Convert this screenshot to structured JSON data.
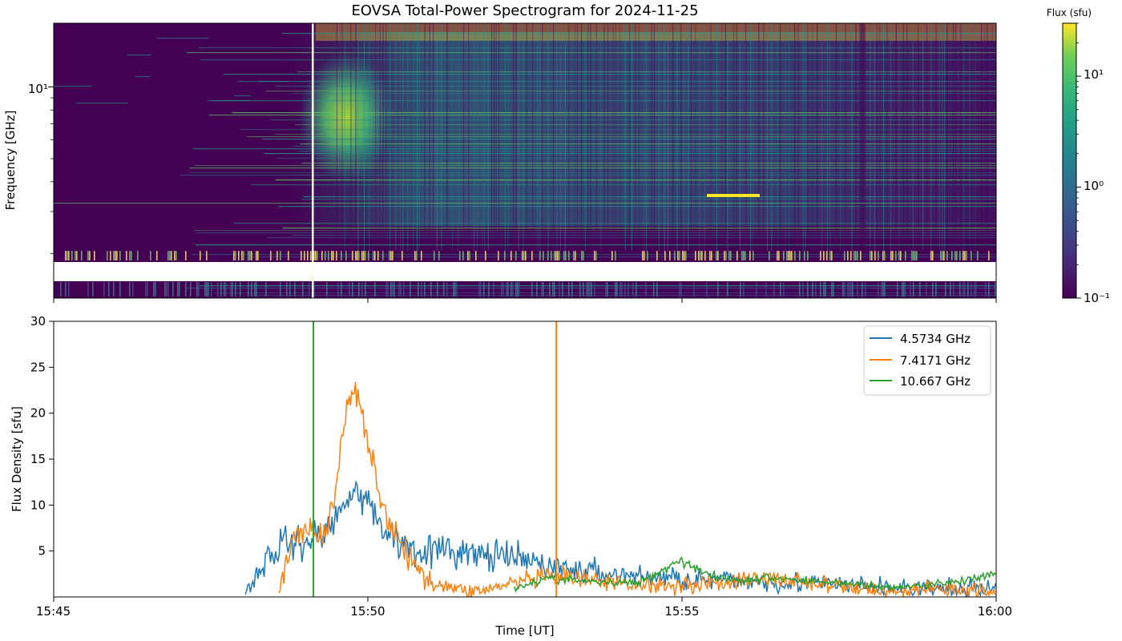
{
  "figure_title": "EOVSA Total-Power Spectrogram for 2024-11-25",
  "chart_data": [
    {
      "type": "heatmap",
      "title": "EOVSA Total-Power Spectrogram for 2024-11-25",
      "xlabel": "",
      "ylabel": "Frequency [GHz]",
      "y_scale": "log",
      "y_tick_labels": [
        "10¹"
      ],
      "y_major_ticks": [
        10
      ],
      "y_minor_ticks": [
        2,
        3,
        4,
        5,
        6,
        7,
        8,
        9,
        20
      ],
      "ylim": [
        1.3,
        18.5
      ],
      "xlim": [
        "15:45",
        "16:00"
      ],
      "x_ticks": [
        "15:45",
        "15:50",
        "15:55",
        "16:00"
      ],
      "colorbar": {
        "label": "Flux (sfu)",
        "scale": "log",
        "colormap": "viridis",
        "range": [
          0.1,
          30
        ],
        "ticks": [
          0.1,
          1,
          10
        ],
        "tick_labels": [
          "10⁻¹",
          "10⁰",
          "10¹"
        ]
      },
      "features": {
        "burst_peak_time": "15:49:40",
        "burst_frequency_range_ghz": [
          4,
          14
        ],
        "vertical_artifact_time": "15:49:07",
        "band_gap_ghz": [
          1.45,
          1.6
        ],
        "yellow_segment": {
          "time_range": [
            "15:55:25",
            "15:56:15"
          ],
          "frequency_ghz": 3.2
        }
      },
      "colors": [
        "#440154",
        "#3b528b",
        "#21918c",
        "#5ec962",
        "#fde725"
      ]
    },
    {
      "type": "line",
      "title": "",
      "xlabel": "Time [UT]",
      "ylabel": "Flux Density [sfu]",
      "xlim": [
        "15:45",
        "16:00"
      ],
      "ylim": [
        0,
        30
      ],
      "grid": false,
      "legend_position": "top-right",
      "x_ticks": [
        "15:45",
        "15:50",
        "15:55",
        "16:00"
      ],
      "y_ticks": [
        5,
        10,
        15,
        20,
        25,
        30
      ],
      "series": [
        {
          "name": "4.5734 GHz",
          "color": "#1f77b4",
          "x": [
            "15:48:03",
            "15:48:20",
            "15:48:35",
            "15:48:50",
            "15:49:05",
            "15:49:20",
            "15:49:35",
            "15:49:45",
            "15:50:00",
            "15:50:15",
            "15:50:30",
            "15:50:50",
            "15:51:10",
            "15:51:30",
            "15:51:50",
            "15:52:10",
            "15:52:30",
            "15:52:50",
            "15:53:10",
            "15:53:40",
            "15:54:00",
            "15:54:30",
            "15:55:00",
            "15:55:30",
            "15:56:00",
            "15:56:30",
            "15:57:00",
            "15:57:30",
            "15:58:00",
            "15:58:30",
            "15:59:00",
            "15:59:30",
            "16:00:00"
          ],
          "y": [
            0.5,
            3.5,
            5.5,
            6.0,
            6.2,
            7.0,
            9.5,
            12.5,
            10.0,
            7.5,
            6.0,
            5.2,
            5.0,
            4.8,
            4.5,
            4.3,
            4.0,
            3.5,
            3.0,
            2.6,
            2.4,
            2.2,
            2.0,
            1.8,
            1.8,
            1.6,
            1.5,
            1.3,
            1.1,
            1.0,
            0.9,
            0.8,
            1.0
          ]
        },
        {
          "name": "7.4171 GHz",
          "color": "#ff7f0e",
          "x": [
            "15:48:35",
            "15:48:50",
            "15:49:05",
            "15:49:20",
            "15:49:30",
            "15:49:40",
            "15:49:50",
            "15:50:00",
            "15:50:10",
            "15:50:20",
            "15:50:35",
            "15:50:50",
            "15:51:05",
            "15:51:20",
            "15:51:40",
            "15:52:00",
            "15:52:30",
            "15:53:00",
            "15:53:30",
            "15:54:00",
            "15:54:30",
            "15:55:00",
            "15:55:30",
            "15:56:00",
            "15:56:30",
            "15:57:00",
            "15:57:30",
            "15:58:00",
            "15:58:30",
            "15:59:00",
            "15:59:30",
            "16:00:00"
          ],
          "y": [
            0.5,
            7.0,
            7.5,
            6.5,
            12.0,
            21.0,
            23.0,
            17.0,
            12.0,
            8.0,
            5.0,
            2.5,
            1.5,
            1.0,
            0.6,
            1.0,
            1.8,
            2.2,
            1.8,
            1.5,
            1.3,
            1.3,
            1.5,
            1.8,
            2.0,
            1.6,
            1.1,
            0.8,
            0.6,
            1.0,
            0.8,
            0.6
          ]
        },
        {
          "name": "10.667 GHz",
          "color": "#2ca02c",
          "x": [
            "15:52:20",
            "15:52:50",
            "15:53:20",
            "15:53:50",
            "15:54:20",
            "15:54:50",
            "15:55:00",
            "15:55:30",
            "15:56:00",
            "15:56:30",
            "15:57:00",
            "15:57:30",
            "15:58:00",
            "15:58:30",
            "15:59:00",
            "15:59:30",
            "16:00:00"
          ],
          "y": [
            1.0,
            2.0,
            1.8,
            1.5,
            1.6,
            3.5,
            4.0,
            2.2,
            1.8,
            2.1,
            1.7,
            1.6,
            1.2,
            1.0,
            1.4,
            1.8,
            2.5
          ]
        }
      ],
      "spikes": [
        {
          "series": "10.667 GHz",
          "time": "15:49:08"
        },
        {
          "series": "7.4171 GHz",
          "time": "15:53:00"
        }
      ],
      "noise_amplitude": [
        3.0,
        2.6,
        1.2
      ]
    }
  ]
}
